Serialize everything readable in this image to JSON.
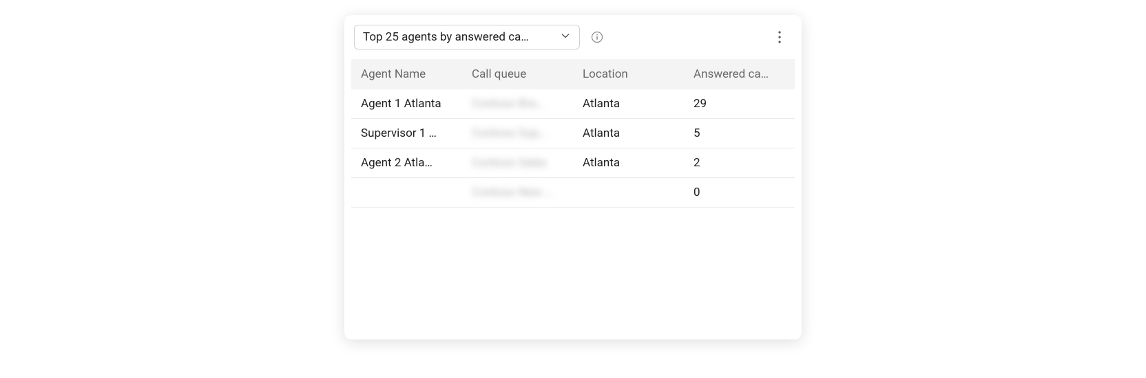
{
  "toolbar": {
    "dropdown_label": "Top 25 agents by answered ca…"
  },
  "table": {
    "columns": {
      "agent": "Agent Name",
      "queue": "Call queue",
      "location": "Location",
      "answered": "Answered ca…"
    },
    "rows": [
      {
        "agent": "Agent 1 Atlanta",
        "queue": "Contoso Bra…",
        "location": "Atlanta",
        "answered": "29"
      },
      {
        "agent": "Supervisor 1 …",
        "queue": "Contoso Sup…",
        "location": "Atlanta",
        "answered": "5"
      },
      {
        "agent": "Agent 2 Atla…",
        "queue": "Contoso Sales",
        "location": "Atlanta",
        "answered": "2"
      },
      {
        "agent": "",
        "queue": "Contoso New …",
        "location": "",
        "answered": "0"
      }
    ]
  }
}
